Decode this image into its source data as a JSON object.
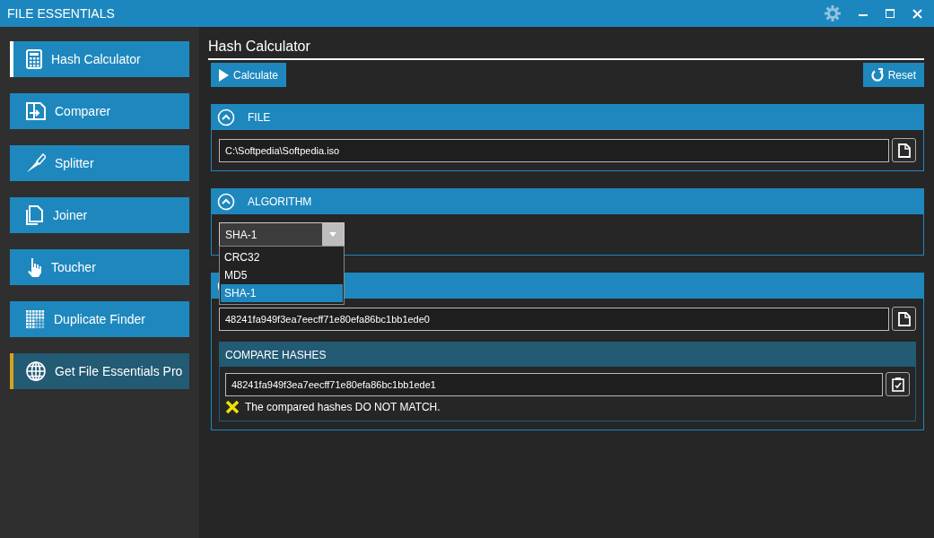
{
  "window": {
    "title": "FILE ESSENTIALS"
  },
  "sidebar": {
    "items": [
      {
        "label": "Hash Calculator",
        "kind": "tool",
        "selected": true
      },
      {
        "label": "Comparer",
        "kind": "tool",
        "selected": false
      },
      {
        "label": "Splitter",
        "kind": "tool",
        "selected": false
      },
      {
        "label": "Joiner",
        "kind": "tool",
        "selected": false
      },
      {
        "label": "Toucher",
        "kind": "tool",
        "selected": false
      },
      {
        "label": "Duplicate Finder",
        "kind": "tool",
        "selected": false
      },
      {
        "label": "Get File Essentials Pro",
        "kind": "promo",
        "selected": false
      }
    ]
  },
  "page": {
    "title": "Hash Calculator",
    "buttons": {
      "calculate": "Calculate",
      "reset": "Reset"
    },
    "file_section": {
      "title": "FILE",
      "expanded": true,
      "path": "C:\\Softpedia\\Softpedia.iso"
    },
    "algorithm_section": {
      "title": "ALGORITHM",
      "expanded": true,
      "value": "SHA-1",
      "dropdown_open": true,
      "options": [
        {
          "label": "CRC32",
          "selected": false
        },
        {
          "label": "MD5",
          "selected": false
        },
        {
          "label": "SHA-1",
          "selected": true
        }
      ]
    },
    "hash_section": {
      "hash": "48241fa949f3ea7eecff71e80efa86bc1bb1ede0",
      "compare": {
        "title": "COMPARE HASHES",
        "value": "48241fa949f3ea7eecff71e80efa86bc1bb1ede1",
        "match": false,
        "message": "The compared hashes DO NOT MATCH."
      }
    }
  }
}
